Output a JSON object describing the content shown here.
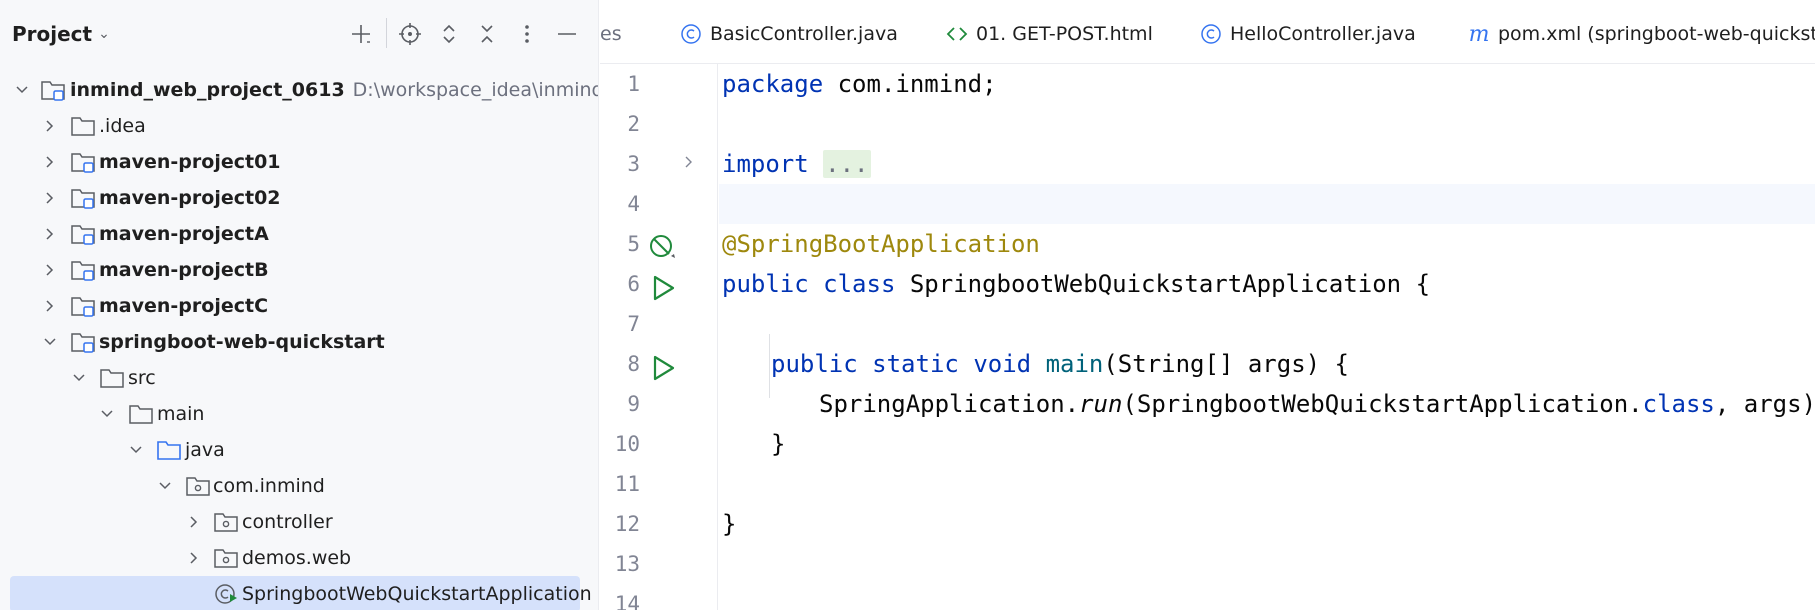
{
  "project_panel": {
    "title": "Project",
    "tree": [
      {
        "label": "inmind_web_project_0613",
        "hint": "D:\\workspace_idea\\inmind\\inmind",
        "type": "module",
        "expanded": true
      },
      {
        "label": ".idea",
        "type": "folder",
        "expanded": false
      },
      {
        "label": "maven-project01",
        "type": "module",
        "expanded": false
      },
      {
        "label": "maven-project02",
        "type": "module",
        "expanded": false
      },
      {
        "label": "maven-projectA",
        "type": "module",
        "expanded": false
      },
      {
        "label": "maven-projectB",
        "type": "module",
        "expanded": false
      },
      {
        "label": "maven-projectC",
        "type": "module",
        "expanded": false
      },
      {
        "label": "springboot-web-quickstart",
        "type": "module",
        "expanded": true
      },
      {
        "label": "src",
        "type": "folder",
        "expanded": true
      },
      {
        "label": "main",
        "type": "folder",
        "expanded": true
      },
      {
        "label": "java",
        "type": "source-folder",
        "expanded": true
      },
      {
        "label": "com.inmind",
        "type": "package",
        "expanded": true
      },
      {
        "label": "controller",
        "type": "package",
        "expanded": false
      },
      {
        "label": "demos.web",
        "type": "package",
        "expanded": false
      },
      {
        "label": "SpringbootWebQuickstartApplication",
        "type": "class-runnable",
        "selected": true
      }
    ]
  },
  "tabs": [
    {
      "label": "es",
      "icon": "partial"
    },
    {
      "label": "BasicController.java",
      "icon": "class-icon"
    },
    {
      "label": "01. GET-POST.html",
      "icon": "html-icon"
    },
    {
      "label": "HelloController.java",
      "icon": "class-icon"
    },
    {
      "label": "pom.xml (springboot-web-quickstar",
      "icon": "maven-icon"
    }
  ],
  "editor": {
    "line_numbers": [
      "1",
      "2",
      "3",
      "4",
      "5",
      "6",
      "7",
      "8",
      "9",
      "10",
      "11",
      "12",
      "13",
      "14"
    ],
    "code": {
      "l1_kw": "package",
      "l1_rest": " com.inmind;",
      "l3_kw": "import",
      "l3_dots": "...",
      "l6_ann": "@SpringBootApplication",
      "l7_kw1": "public",
      "l7_kw2": "class",
      "l7_rest": " SpringbootWebQuickstartApplication {",
      "l9_kw1": "public",
      "l9_kw2": "static",
      "l9_kw3": "void",
      "l9_fn": "main",
      "l9_rest": "(String[] args) {",
      "l10_a": "SpringApplication.",
      "l10_run": "run",
      "l10_b": "(SpringbootWebQuickstartApplication.",
      "l10_class": "class",
      "l10_c": ", args);",
      "l11": "}",
      "l13": "}"
    }
  }
}
